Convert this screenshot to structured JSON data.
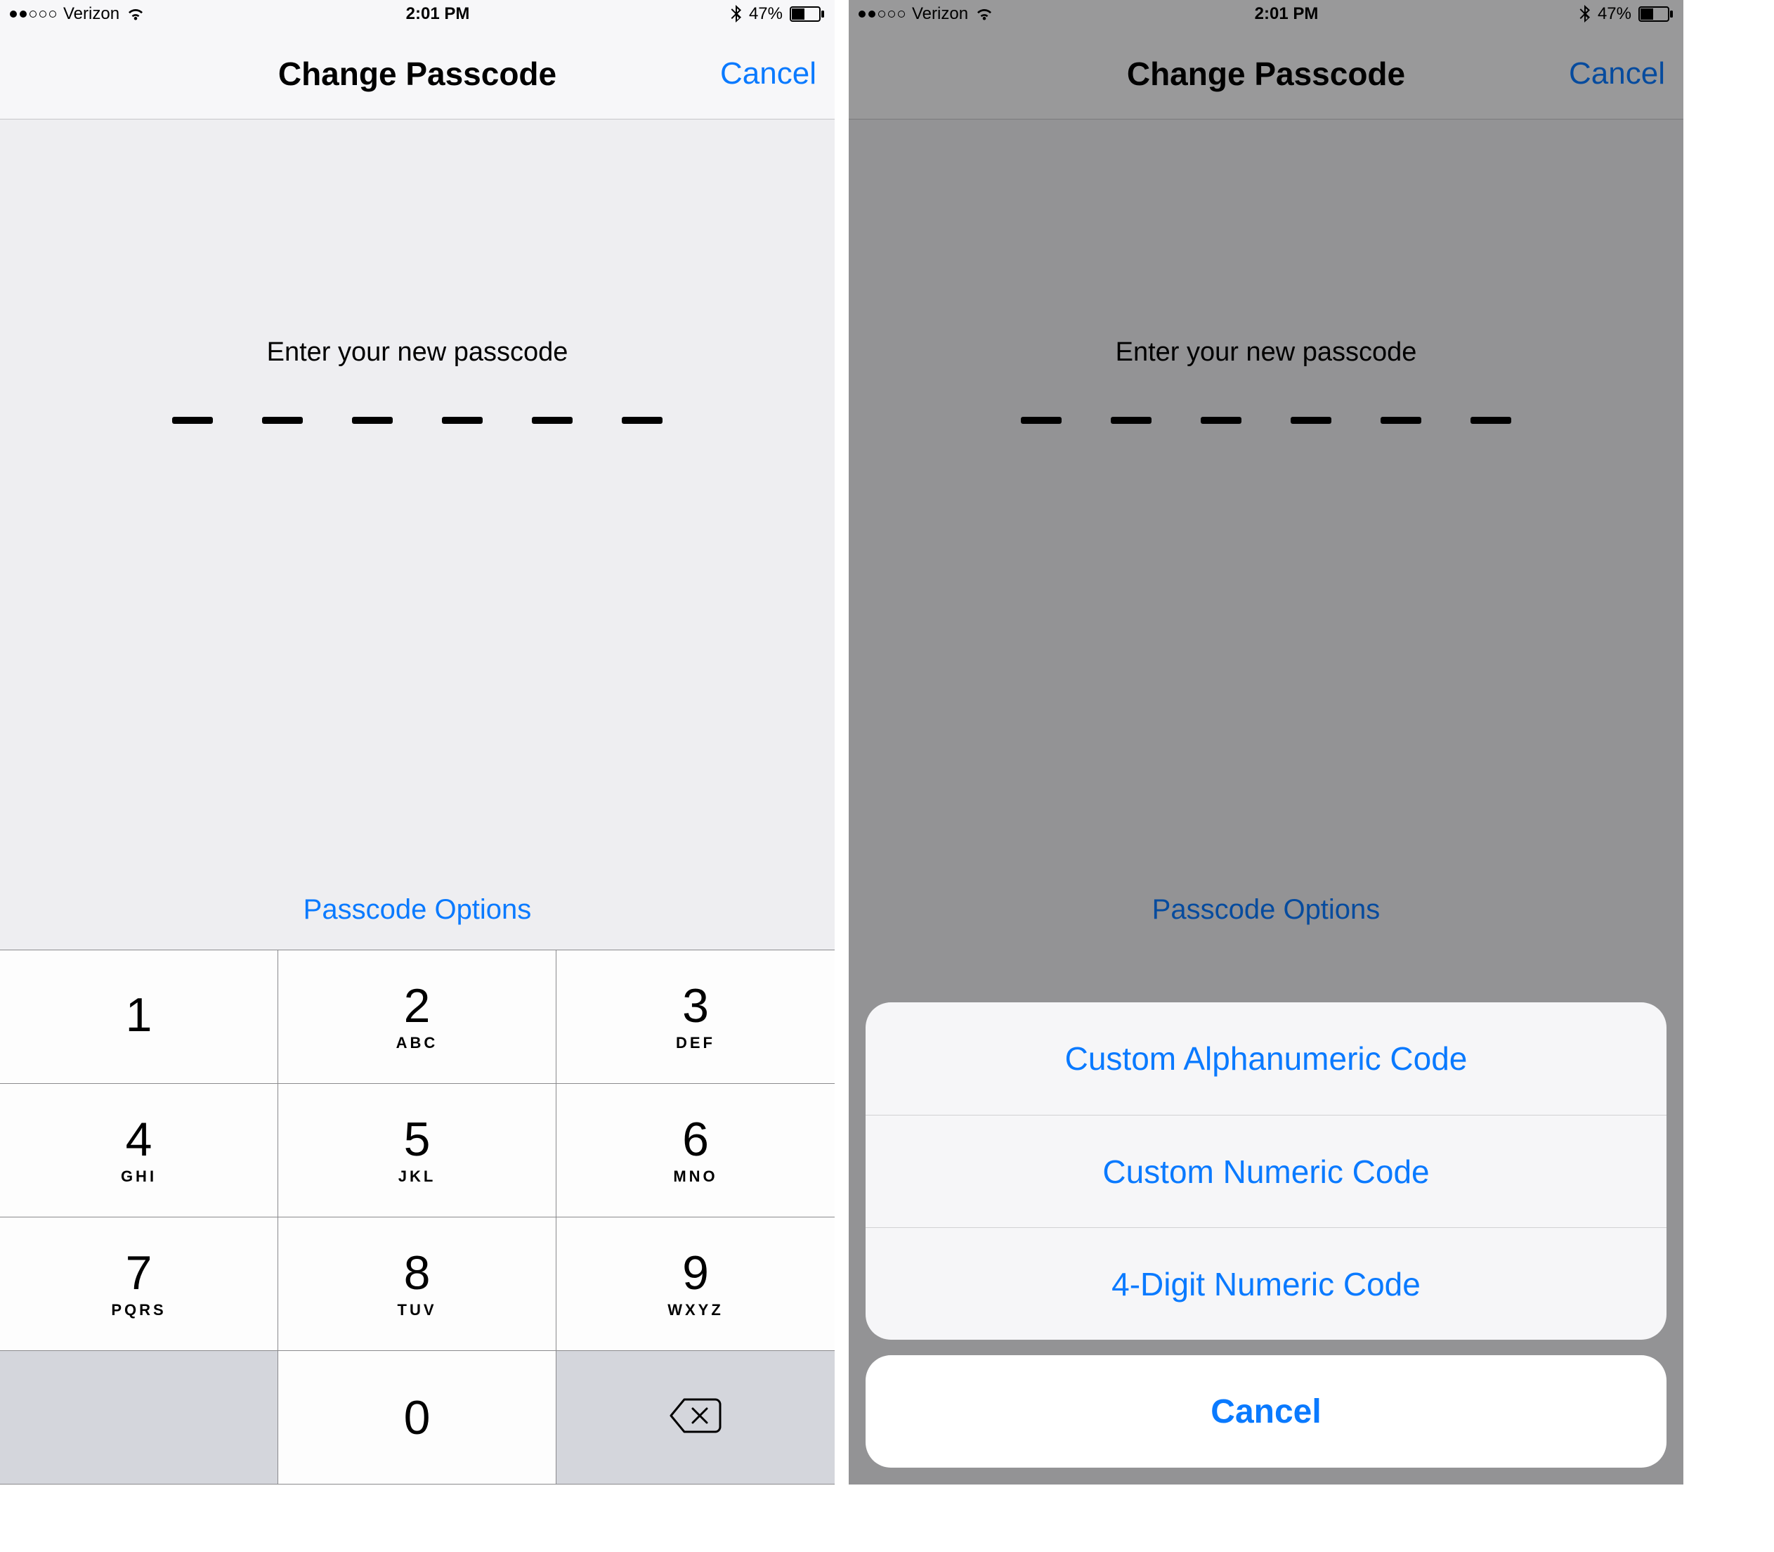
{
  "status": {
    "carrier": "Verizon",
    "time": "2:01 PM",
    "battery_pct": "47%"
  },
  "nav": {
    "title": "Change Passcode",
    "cancel": "Cancel"
  },
  "prompt": "Enter your new passcode",
  "options_link": "Passcode Options",
  "keypad": {
    "k1_num": "1",
    "k1_let": "",
    "k2_num": "2",
    "k2_let": "ABC",
    "k3_num": "3",
    "k3_let": "DEF",
    "k4_num": "4",
    "k4_let": "GHI",
    "k5_num": "5",
    "k5_let": "JKL",
    "k6_num": "6",
    "k6_let": "MNO",
    "k7_num": "7",
    "k7_let": "PQRS",
    "k8_num": "8",
    "k8_let": "TUV",
    "k9_num": "9",
    "k9_let": "WXYZ",
    "k0_num": "0"
  },
  "sheet": {
    "opt1": "Custom Alphanumeric Code",
    "opt2": "Custom Numeric Code",
    "opt3": "4-Digit Numeric Code",
    "cancel": "Cancel"
  }
}
